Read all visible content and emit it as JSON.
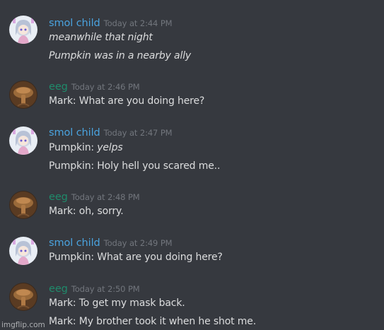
{
  "colors": {
    "background": "#36393f",
    "smol_child_name": "#4aa3df",
    "eeg_name": "#1f8b6b",
    "timestamp": "#72767d",
    "message_text": "#dcddde"
  },
  "users": {
    "smol": {
      "name": "smol child",
      "avatar_icon": "anime-girl-avatar-icon"
    },
    "eeg": {
      "name": "eeg",
      "avatar_icon": "mushroom-avatar-icon"
    }
  },
  "messages": [
    {
      "user": "smol child",
      "time": "Today at 2:44 PM",
      "lines": [
        "meanwhile that night",
        "Pumpkin was in a nearby ally"
      ]
    },
    {
      "user": "eeg",
      "time": "Today at 2:46 PM",
      "lines": [
        "Mark: What are you doing here?"
      ]
    },
    {
      "user": "smol child",
      "time": "Today at 2:47 PM",
      "lines": [
        {
          "prefix": "Pumpkin: ",
          "italic": "yelps"
        },
        "Pumpkin: Holy hell you scared me.."
      ]
    },
    {
      "user": "eeg",
      "time": "Today at 2:48 PM",
      "lines": [
        "Mark: oh, sorry."
      ]
    },
    {
      "user": "smol child",
      "time": "Today at 2:49 PM",
      "lines": [
        "Pumpkin: What are you doing here?"
      ]
    },
    {
      "user": "eeg",
      "time": "Today at 2:50 PM",
      "lines": [
        "Mark: To get my mask back.",
        "Mark: My brother took it when he shot me."
      ]
    }
  ],
  "watermark": "imgflip.com"
}
